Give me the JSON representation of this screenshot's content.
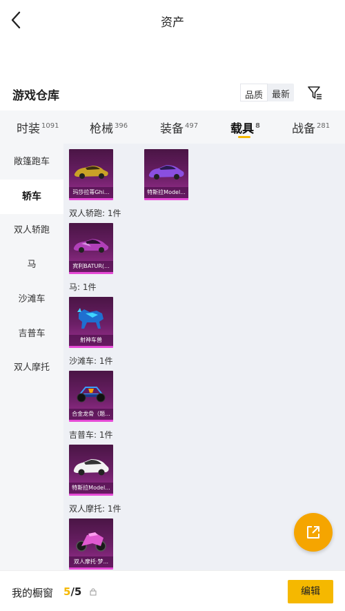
{
  "header": {
    "title": "资产"
  },
  "section": {
    "title": "游戏仓库",
    "sort_options": [
      "品质",
      "最新"
    ]
  },
  "tabs": [
    {
      "label": "时装",
      "count": "1091"
    },
    {
      "label": "枪械",
      "count": "396"
    },
    {
      "label": "装备",
      "count": "497"
    },
    {
      "label": "载具",
      "count": "8"
    },
    {
      "label": "战备",
      "count": "281"
    }
  ],
  "active_tab": "载具",
  "sidebar": {
    "items": [
      "敞篷跑车",
      "轿车",
      "双人轿跑",
      "马",
      "沙滩车",
      "吉普车",
      "双人摩托"
    ],
    "active": "轿车"
  },
  "groups": [
    {
      "label": "",
      "items": [
        {
          "caption": "玛莎拉蒂Ghi...",
          "icon": "gold-sports-car-icon"
        },
        {
          "caption": "特斯拉Model...",
          "icon": "purple-sedan-icon"
        }
      ]
    },
    {
      "label": "双人轿跑: 1件",
      "items": [
        {
          "caption": "宾利BATUR(...",
          "icon": "purple-coupe-icon"
        }
      ]
    },
    {
      "label": "马: 1件",
      "items": [
        {
          "caption": "射神车兽",
          "icon": "mech-beast-icon"
        }
      ]
    },
    {
      "label": "沙滩车: 1件",
      "items": [
        {
          "caption": "合金龙骨（题...",
          "icon": "dune-buggy-icon"
        }
      ]
    },
    {
      "label": "吉普车: 1件",
      "items": [
        {
          "caption": "特斯拉Model...",
          "icon": "white-suv-icon"
        }
      ]
    },
    {
      "label": "双人摩托: 1件",
      "items": [
        {
          "caption": "双人摩托·梦...",
          "icon": "pink-motorcycle-icon"
        }
      ]
    }
  ],
  "bottom": {
    "showcase_label": "我的橱窗",
    "current": "5",
    "total": "/5",
    "edit_label": "编辑"
  },
  "colors": {
    "accent": "#f5b800",
    "card": "#6b1f66",
    "card_border": "#e64ad6"
  }
}
